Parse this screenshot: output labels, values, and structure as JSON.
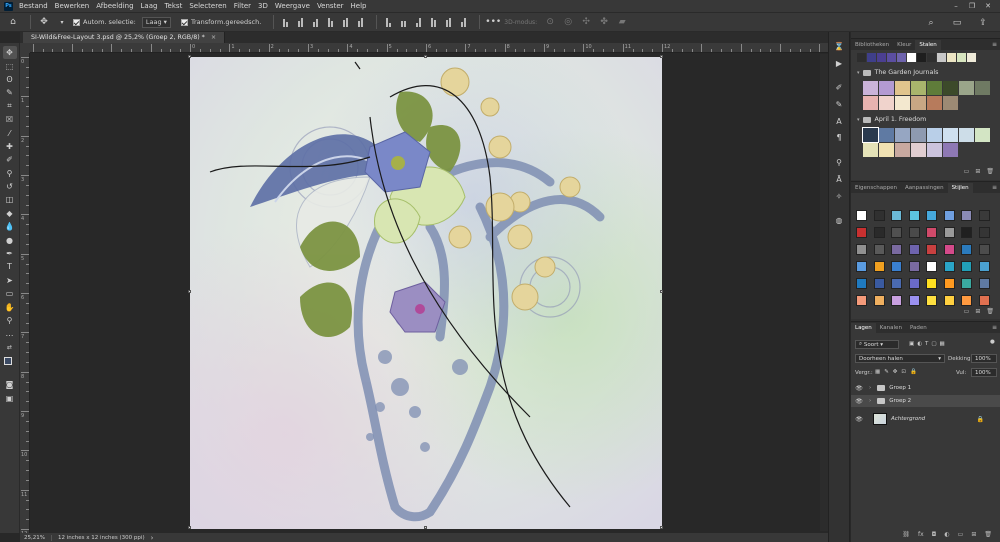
{
  "menubar": {
    "logo": "Ps",
    "items": [
      "Bestand",
      "Bewerken",
      "Afbeelding",
      "Laag",
      "Tekst",
      "Selecteren",
      "Filter",
      "3D",
      "Weergave",
      "Venster",
      "Help"
    ],
    "window_controls": [
      "–",
      "❐",
      "✕"
    ]
  },
  "options": {
    "auto_select_label": "Autom. selectie:",
    "auto_select_target": "Laag",
    "transform_label": "Transform.gereedsch.",
    "mode_3d_label": "3D-modus:"
  },
  "document": {
    "tab_title": "SI-Wild&Free-Layout 3.psd @ 25,2% (Groep 2, RGB/8) *",
    "tab_close": "×"
  },
  "ruler": {
    "h_labels": [
      "0",
      "1",
      "2",
      "3",
      "4",
      "5",
      "6",
      "7",
      "8",
      "9",
      "10",
      "11",
      "12"
    ],
    "v_labels": [
      "0",
      "1",
      "2",
      "3",
      "4",
      "5",
      "6",
      "7",
      "8",
      "9",
      "10",
      "11",
      "12"
    ]
  },
  "status": {
    "zoom": "25,21%",
    "doc_size": "12 inches x 12 inches (300 ppi)",
    "arrow": "›"
  },
  "panels": {
    "swatches_tabs": [
      "Bibliotheken",
      "Kleur",
      "Stalen"
    ],
    "swatches_active": "Stalen",
    "top_swatches": [
      "#2d2d2d",
      "#3f3f8a",
      "#4b3f91",
      "#5b4ea1",
      "#6e63ad",
      "#ffffff",
      "#1e1e1e",
      "#2f2f2f",
      "#c8c8c8",
      "#ede6c4",
      "#d8e6c0",
      "#f0ecda"
    ],
    "groups": [
      {
        "name": "The Garden Journals",
        "colors": [
          "#cab3d9",
          "#b39ad2",
          "#e0c48d",
          "#a9b56c",
          "#5f7c3a",
          "#3c4a2a",
          "#9aa58a",
          "#6f7a63",
          "#e8b3b0",
          "#f0d3cc",
          "#f3e8cf",
          "#c8a784",
          "#b77b5c",
          "#9c8a74"
        ]
      },
      {
        "name": "April 1. Freedom",
        "colors": [
          "#2a3a4e",
          "#5f7aa3",
          "#96a6c2",
          "#8e9ab0",
          "#b9cfe8",
          "#cfe0ef",
          "#cddde8",
          "#d3e5c4",
          "#e5e3b8",
          "#f0e1b2",
          "#c8a9a0",
          "#e0cdd0",
          "#cbc3dd",
          "#8e78b4"
        ]
      }
    ],
    "styles_tabs": [
      "Eigenschappen",
      "Aanpassingen",
      "Stijlen"
    ],
    "styles_active": "Stijlen",
    "styles_colors": [
      "#ffffff",
      "#303030",
      "#6bb9d6",
      "#5cc6e0",
      "#46a9dd",
      "#6f9fe0",
      "#8a8ab5",
      "#3a3a3a",
      "#c83030",
      "#2a2a2a",
      "#505050",
      "#4a4a4a",
      "#d04a6a",
      "#9a9a9a",
      "#202020",
      "#353535",
      "#909090",
      "#5a5a5a",
      "#7a6aa0",
      "#6e63ad",
      "#c84040",
      "#d44a8a",
      "#2b7bbd",
      "#4c4c4c",
      "#5a9be0",
      "#f0a020",
      "#3a80d0",
      "#7a6aa0",
      "#ffffff",
      "#2aa5c8",
      "#22a0b8",
      "#4aa0d0",
      "#1f7ac0",
      "#3a5aa0",
      "#4a6ab0",
      "#6a6ac8",
      "#ffe020",
      "#ff9a20",
      "#3aa9a0",
      "#5f7aa3",
      "#f49a7a",
      "#f0b060",
      "#c9a0e0",
      "#9a90f0",
      "#ffe040",
      "#ffd040",
      "#ff9a40",
      "#e07050"
    ],
    "layers_tabs": [
      "Lagen",
      "Kanalen",
      "Paden"
    ],
    "layers_active": "Lagen",
    "filter_kind": "Soort",
    "blend_mode": "Doorheen halen",
    "opacity_label": "Dekking:",
    "opacity_value": "100%",
    "lock_label": "Vergr.:",
    "fill_label": "Vul:",
    "fill_value": "100%",
    "layers": [
      {
        "name": "Groep 1",
        "type": "group",
        "selected": false
      },
      {
        "name": "Groep 2",
        "type": "group",
        "selected": true
      },
      {
        "name": "Achtergrond",
        "type": "image",
        "selected": false
      }
    ]
  },
  "colors": {
    "foreground": "#3b4a64",
    "background": "#000000"
  }
}
